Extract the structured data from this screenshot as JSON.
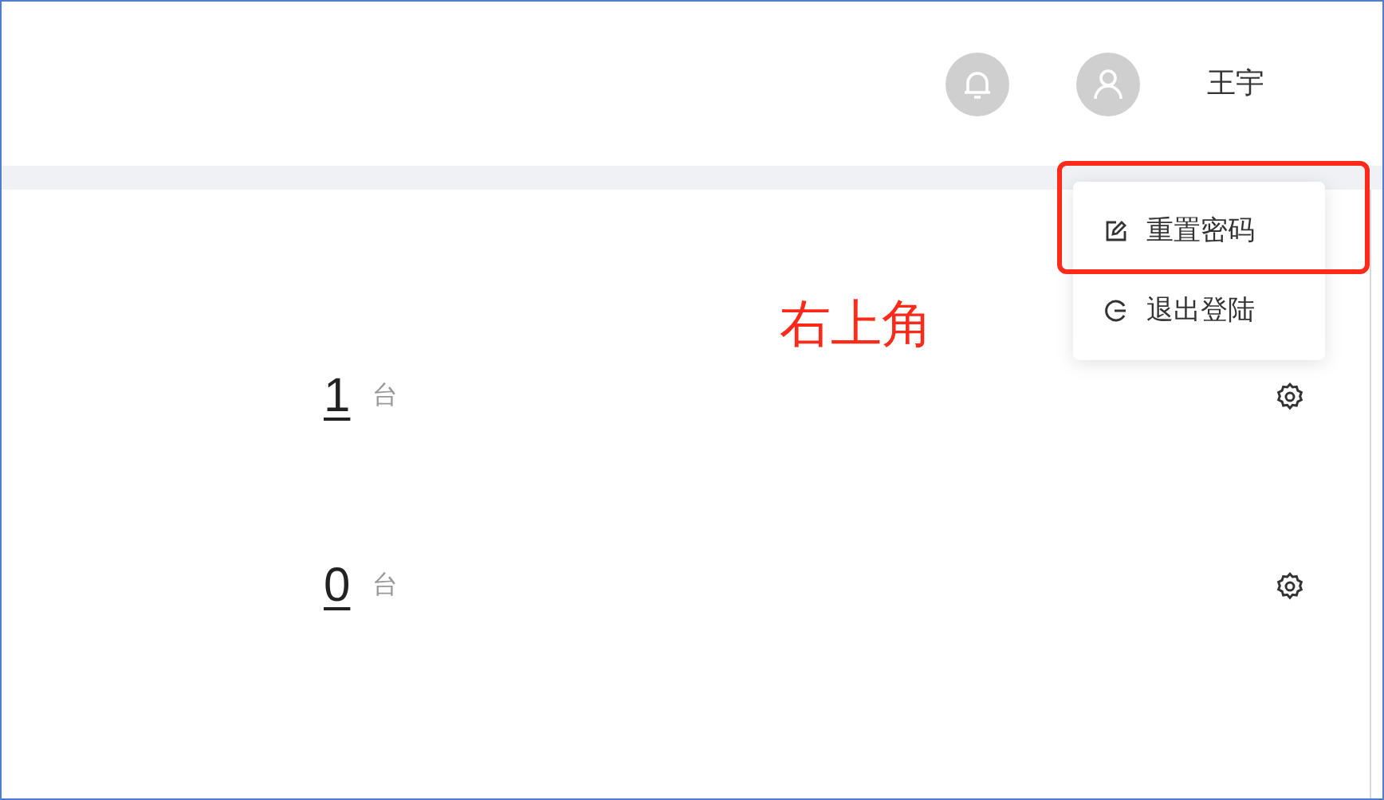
{
  "header": {
    "user_name": "王宇"
  },
  "stats": [
    {
      "value": "1",
      "unit": "台"
    },
    {
      "value": "0",
      "unit": "台"
    }
  ],
  "user_menu": [
    {
      "label": "重置密码",
      "kind": "edit",
      "highlighted": true
    },
    {
      "label": "退出登陆",
      "kind": "logout",
      "highlighted": false
    }
  ],
  "annotation": {
    "text": "右上角"
  }
}
